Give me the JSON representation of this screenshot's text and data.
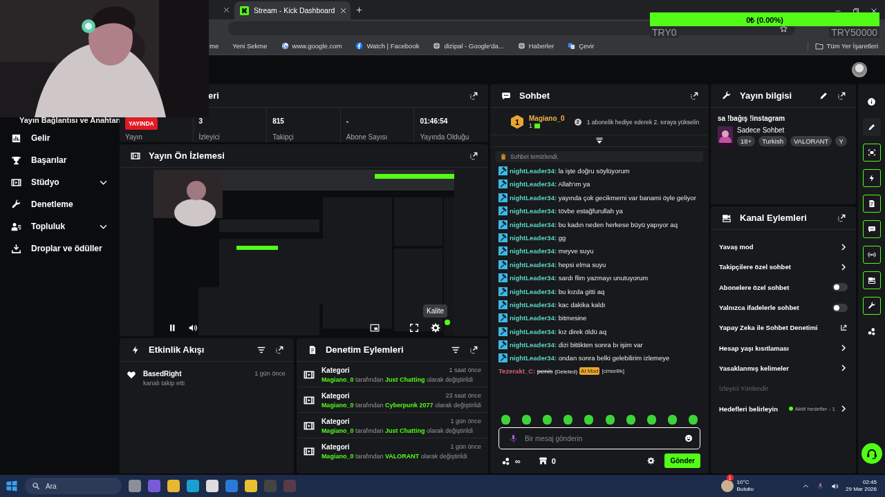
{
  "browser": {
    "tabs": [
      {
        "title": "Stream - Kick Dashboard",
        "selected": true
      }
    ],
    "bookmarks": [
      {
        "kind": "plain",
        "label": "me"
      },
      {
        "kind": "plain",
        "label": "Yeni Sekme"
      },
      {
        "kind": "google",
        "label": "www.google.com"
      },
      {
        "kind": "facebook",
        "label": "Watch | Facebook"
      },
      {
        "kind": "globe",
        "label": "dizipal - Google'da..."
      },
      {
        "kind": "globe",
        "label": "Haberler"
      },
      {
        "kind": "translate",
        "label": "Çevir"
      }
    ],
    "all_bookmarks": "Tüm Yer İşaretleri"
  },
  "goal_overlay": {
    "amount": "0₺ (0.00%)",
    "min": "TRY0",
    "max": "TRY50000"
  },
  "sidebar": {
    "partial_item": "Yayın Bağlantısı ve Anahtarı",
    "items": [
      {
        "kind": "link",
        "label": "Gelir"
      },
      {
        "kind": "link",
        "label": "Başarılar"
      },
      {
        "kind": "group",
        "label": "Stüdyo"
      },
      {
        "kind": "link",
        "label": "Denetleme"
      },
      {
        "kind": "group",
        "label": "Topluluk"
      },
      {
        "kind": "link",
        "label": "Droplar ve ödüller"
      }
    ]
  },
  "stream_stats": {
    "title": "eri",
    "status": "YAYINDA",
    "status_label": "Yayın",
    "stats": [
      {
        "value": "3",
        "label": "İzleyici"
      },
      {
        "value": "815",
        "label": "Takipçi"
      },
      {
        "value": "-",
        "label": "Abone Sayısı"
      },
      {
        "value": "01:46:54",
        "label": "Yayında Olduğu"
      }
    ]
  },
  "preview": {
    "title": "Yayın Ön İzlemesi",
    "tooltip": "Kalite"
  },
  "activity": {
    "title": "Etkinlik Akışı",
    "items": [
      {
        "user": "BasedRight",
        "text": "kanalı takip etti",
        "time": "1 gün önce"
      }
    ]
  },
  "moderation": {
    "title": "Denetim Eylemleri",
    "items": [
      {
        "title": "Kategori",
        "time": "1 saat önce",
        "description": "**Magiano_0** tarafından **Just Chatting** olarak değiştirildi"
      },
      {
        "title": "Kategori",
        "time": "23 saat önce",
        "description": "**Magiano_0** tarafından **Cyberpunk 2077** olarak değiştirildi"
      },
      {
        "title": "Kategori",
        "time": "1 gün önce",
        "description": "**Magiano_0** tarafından **Just Chatting** olarak değiştirildi"
      },
      {
        "title": "Kategori",
        "time": "1 gün önce",
        "description": "**Magiano_0** tarafından **VALORANT** olarak değiştirildi"
      }
    ]
  },
  "chat": {
    "title": "Sohbet",
    "leader": {
      "rank": "1",
      "user": "Magiano_0",
      "count": "1"
    },
    "promo_rank": "2",
    "promo": "1 abonelik hediye ederek 2. sıraya yükselin",
    "system": "Sohbet temizlendi.",
    "messages": [
      {
        "kind": "normal",
        "user": "nightLeader34:",
        "text": "la işte doğru söylüyorum"
      },
      {
        "kind": "normal",
        "user": "nightLeader34:",
        "text": "Allah'ım ya"
      },
      {
        "kind": "normal",
        "user": "nightLeader34:",
        "text": "yayında çok gecikmemi var banami öyle geliyor"
      },
      {
        "kind": "normal",
        "user": "nightLeader34:",
        "text": "tövbe estağfurullah ya"
      },
      {
        "kind": "normal",
        "user": "nightLeader34:",
        "text": "bu kadın neden herkese büyü yapıyor aq"
      },
      {
        "kind": "normal",
        "user": "nightLeader34:",
        "text": "gg"
      },
      {
        "kind": "normal",
        "user": "nightLeader34:",
        "text": "meyve suyu"
      },
      {
        "kind": "normal",
        "user": "nightLeader34:",
        "text": "hepsi elma suyu"
      },
      {
        "kind": "normal",
        "user": "nightLeader34:",
        "text": "sardı flim yazmayı unutuyorum"
      },
      {
        "kind": "normal",
        "user": "nightLeader34:",
        "text": "bu kızda gitti aq"
      },
      {
        "kind": "normal",
        "user": "nightLeader34:",
        "text": "kac dakika kaldı"
      },
      {
        "kind": "normal",
        "user": "nightLeader34:",
        "text": "bitmesine"
      },
      {
        "kind": "normal",
        "user": "nightLeader34:",
        "text": "kız direk öldü aq"
      },
      {
        "kind": "normal",
        "user": "nightLeader34:",
        "text": "dizi bittikten sonra bı işim var"
      },
      {
        "kind": "normal",
        "user": "nightLeader34:",
        "text": "ondan sonra belki gelebilirim izlemeye"
      },
      {
        "kind": "deleted",
        "user": "Tezerakt_C:",
        "text": "penis",
        "note": "(Deleted)",
        "badge": "AI Mod",
        "reason": "[cinsellik]"
      }
    ],
    "placeholder": "Bir mesaj gönderin",
    "points": "∞",
    "shop_count": "0",
    "send": "Gönder"
  },
  "stream_info": {
    "title": "Yayın bilgisi",
    "stream_title": "sa !bağış !instagram",
    "category": "Sadece Sohbet",
    "tags": [
      "18+",
      "Turkish",
      "VALORANT",
      "Y"
    ]
  },
  "channel_actions": {
    "title": "Kanal Eylemleri",
    "items": [
      {
        "kind": "link",
        "label": "Yavaş mod"
      },
      {
        "kind": "link",
        "label": "Takipçilere özel sohbet"
      },
      {
        "kind": "toggle",
        "label": "Abonelere özel sohbet",
        "on": false
      },
      {
        "kind": "toggle",
        "label": "Yalnızca ifadelerle sohbet",
        "on": false
      },
      {
        "kind": "external",
        "label": "Yapay Zeka ile Sohbet Denetimi"
      },
      {
        "kind": "link",
        "label": "Hesap yaşı kısıtlaması"
      },
      {
        "kind": "link",
        "label": "Yasaklanmış kelimeler"
      },
      {
        "kind": "section",
        "label": "İzleyici Yönlendir"
      },
      {
        "kind": "goal",
        "label": "Hedefleri belirleyin",
        "status": "Aktif hedefler - 1"
      }
    ]
  },
  "taskbar": {
    "search": "Ara",
    "weather": {
      "badge": "1",
      "temp": "10°C",
      "condition": "Bulutlu"
    },
    "time": "02:45",
    "date": "29 Mar 2026"
  }
}
